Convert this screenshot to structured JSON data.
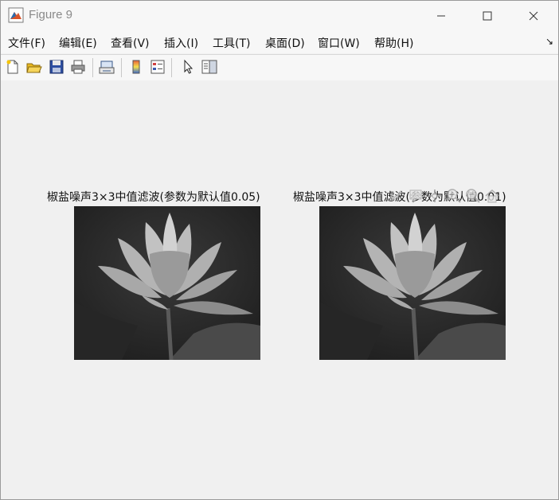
{
  "window": {
    "title": "Figure 9"
  },
  "menu": [
    "文件(F)",
    "编辑(E)",
    "查看(V)",
    "插入(I)",
    "工具(T)",
    "桌面(D)",
    "窗口(W)",
    "帮助(H)"
  ],
  "toolbar": [
    "new-figure-icon",
    "open-file-icon",
    "save-icon",
    "print-icon",
    "link-plot-icon",
    "colorbar-icon",
    "legend-icon",
    "select-pointer-icon",
    "property-editor-icon"
  ],
  "axes": [
    {
      "title": "椒盐噪声3×3中值滤波(参数为默认值0.05)"
    },
    {
      "title": "椒盐噪声3×3中值滤波(参数为默认值0.01)"
    }
  ],
  "colors": {
    "window_bg": "#f0f0f0",
    "titlebar_bg": "#f7f7f7"
  }
}
